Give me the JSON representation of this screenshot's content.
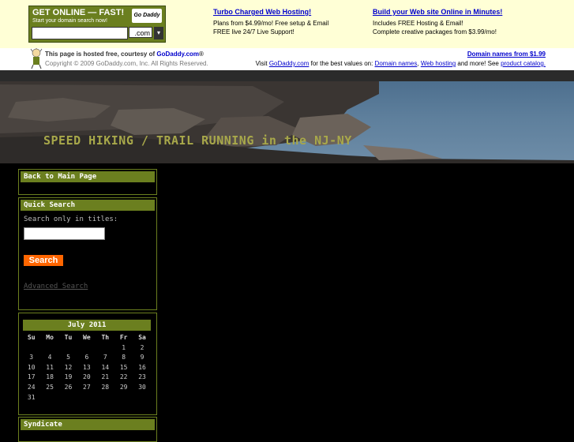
{
  "ad": {
    "promo_title": "GET ONLINE — FAST!",
    "promo_sub": "Start your domain search now!",
    "logo_text": "Go Daddy",
    "tld": ".com",
    "col1": {
      "link": "Turbo Charged Web Hosting!",
      "line1": "Plans from $4.99/mo! Free setup & Email",
      "line2": "FREE live 24/7 Live Support!"
    },
    "col2": {
      "link": "Build your Web site Online in Minutes!",
      "line1": "Includes FREE Hosting & Email!",
      "line2": "Complete creative packages from $3.99/mo!"
    }
  },
  "host": {
    "line1_pre": "This page is hosted free, courtesy of ",
    "line1_link": "GoDaddy.com",
    "line1_post": "®",
    "copyright": "Copyright © 2009 GoDaddy.com, Inc. All Rights Reserved.",
    "right_link": "Domain names from $1.99",
    "r2_pre": "Visit ",
    "r2_link1": "GoDaddy.com",
    "r2_mid1": " for the best values on: ",
    "r2_link2": "Domain names",
    "r2_mid2": ", ",
    "r2_link3": "Web hosting",
    "r2_mid3": " and more! See ",
    "r2_link4": "product catalog."
  },
  "banner": {
    "title": "SPEED HIKING / TRAIL RUNNING in the NJ-NY"
  },
  "sidebar": {
    "main_link": "Back to Main Page",
    "search": {
      "head": "Quick Search",
      "label": "Search only in titles:",
      "button": "Search",
      "advanced": "Advanced Search"
    },
    "calendar": {
      "month": "July 2011",
      "days": [
        "Su",
        "Mo",
        "Tu",
        "We",
        "Th",
        "Fr",
        "Sa"
      ],
      "weeks": [
        [
          "",
          "",
          "",
          "",
          "",
          "1",
          "2"
        ],
        [
          "3",
          "4",
          "5",
          "6",
          "7",
          "8",
          "9"
        ],
        [
          "10",
          "11",
          "12",
          "13",
          "14",
          "15",
          "16"
        ],
        [
          "17",
          "18",
          "19",
          "20",
          "21",
          "22",
          "23"
        ],
        [
          "24",
          "25",
          "26",
          "27",
          "28",
          "29",
          "30"
        ],
        [
          "31",
          "",
          "",
          "",
          "",
          "",
          ""
        ]
      ]
    },
    "syndicate": "Syndicate"
  },
  "colors": {
    "accent": "#6b7f1f",
    "search_button": "#ff6600",
    "link": "#0000cc"
  }
}
